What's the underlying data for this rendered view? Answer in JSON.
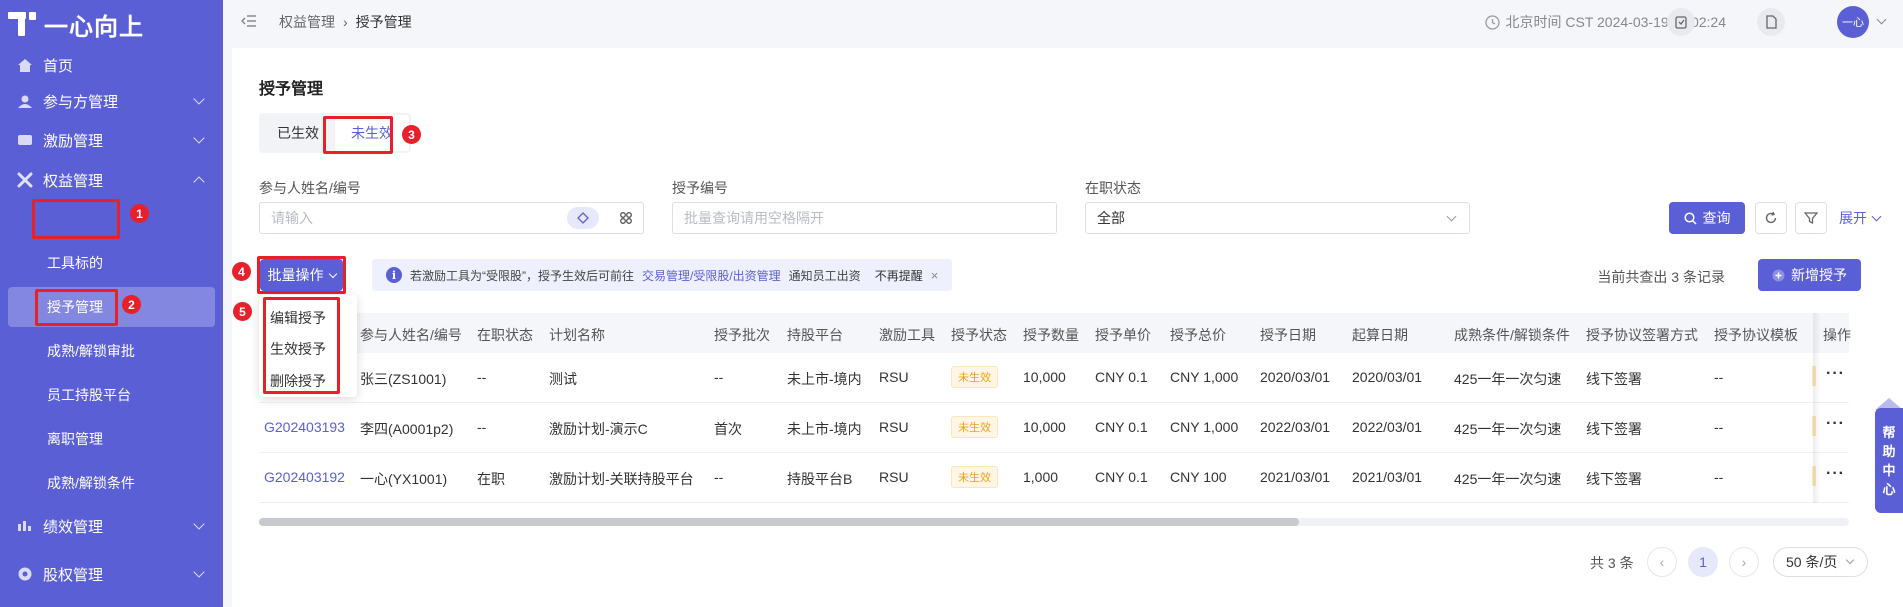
{
  "brand": {
    "logo_text": "一心向上"
  },
  "sidebar": {
    "items": [
      {
        "label": "首页",
        "icon": "home-icon"
      },
      {
        "label": "参与方管理",
        "icon": "participant-icon",
        "expandable": true
      },
      {
        "label": "激励管理",
        "icon": "incentive-icon",
        "expandable": true
      },
      {
        "label": "权益管理",
        "icon": "equity-icon",
        "expandable": true,
        "expanded": true
      },
      {
        "label": "绩效管理",
        "icon": "performance-icon",
        "expandable": true
      },
      {
        "label": "股权管理",
        "icon": "stock-icon",
        "expandable": true
      }
    ],
    "subitems": [
      {
        "label": "工具标的"
      },
      {
        "label": "授予管理",
        "active": true
      },
      {
        "label": "成熟/解锁审批"
      },
      {
        "label": "员工持股平台"
      },
      {
        "label": "离职管理"
      },
      {
        "label": "成熟/解锁条件"
      }
    ]
  },
  "header": {
    "breadcrumb": [
      "权益管理",
      "授予管理"
    ],
    "clock": "北京时间 CST 2024-03-19 11:02:24",
    "avatar": "一心"
  },
  "page": {
    "title": "授予管理",
    "tabs": [
      "已生效",
      "未生效"
    ],
    "active_tab": 1
  },
  "filters": {
    "participant": {
      "label": "参与人姓名/编号",
      "placeholder": "请输入"
    },
    "grant_no": {
      "label": "授予编号",
      "placeholder": "批量查询请用空格隔开"
    },
    "status": {
      "label": "在职状态",
      "value": "全部"
    },
    "query_label": "查询",
    "expand_label": "展开"
  },
  "toolbar": {
    "bulk_label": "批量操作",
    "notice_prefix": "若激励工具为“受限股”，授予生效后可前往",
    "notice_link": "交易管理/受限股/出资管理",
    "notice_suffix": "通知员工出资",
    "notice_dismiss": "不再提醒",
    "record_count": "当前共查出 3 条记录",
    "add_label": "新增授予"
  },
  "dropdown": {
    "items": [
      "编辑授予",
      "生效授予",
      "删除授予"
    ]
  },
  "table": {
    "columns": [
      "参与人姓名/编号",
      "在职状态",
      "计划名称",
      "授予批次",
      "持股平台",
      "激励工具",
      "授予状态",
      "授予数量",
      "授予单价",
      "授予总价",
      "授予日期",
      "起算日期",
      "成熟条件/解锁条件",
      "授予协议签署方式",
      "授予协议模板",
      "操作"
    ],
    "rows": [
      {
        "id": "",
        "participant": "张三(ZS1001)",
        "status": "--",
        "plan": "测试",
        "batch": "--",
        "platform": "未上市-境内",
        "tool": "RSU",
        "grant_status": "未生效",
        "qty": "10,000",
        "unit": "CNY  0.1",
        "total": "CNY  1,000",
        "grant_date": "2020/03/01",
        "start_date": "2020/03/01",
        "condition": "425一年一次匀速",
        "sign": "线下签署",
        "template": "--"
      },
      {
        "id": "G202403193",
        "participant": "李四(A0001p2)",
        "status": "--",
        "plan": "激励计划-演示C",
        "batch": "首次",
        "platform": "未上市-境内",
        "tool": "RSU",
        "grant_status": "未生效",
        "qty": "10,000",
        "unit": "CNY  0.1",
        "total": "CNY  1,000",
        "grant_date": "2022/03/01",
        "start_date": "2022/03/01",
        "condition": "425一年一次匀速",
        "sign": "线下签署",
        "template": "--"
      },
      {
        "id": "G202403192",
        "participant": "一心(YX1001)",
        "status": "在职",
        "plan": "激励计划-关联持股平台",
        "batch": "--",
        "platform": "持股平台B",
        "tool": "RSU",
        "grant_status": "未生效",
        "qty": "1,000",
        "unit": "CNY  0.1",
        "total": "CNY  100",
        "grant_date": "2021/03/01",
        "start_date": "2021/03/01",
        "condition": "425一年一次匀速",
        "sign": "线下签署",
        "template": "--"
      }
    ],
    "more": "···"
  },
  "pagination": {
    "total": "共 3 条",
    "current": "1",
    "page_size": "50 条/页"
  },
  "help": {
    "label": [
      "帮",
      "助",
      "中",
      "心"
    ]
  },
  "annotations": [
    "1",
    "2",
    "3",
    "4",
    "5"
  ],
  "colors": {
    "primary": "#5b5fd6",
    "annotation_red": "#e8202a",
    "pending_tag": "#f0a020"
  }
}
